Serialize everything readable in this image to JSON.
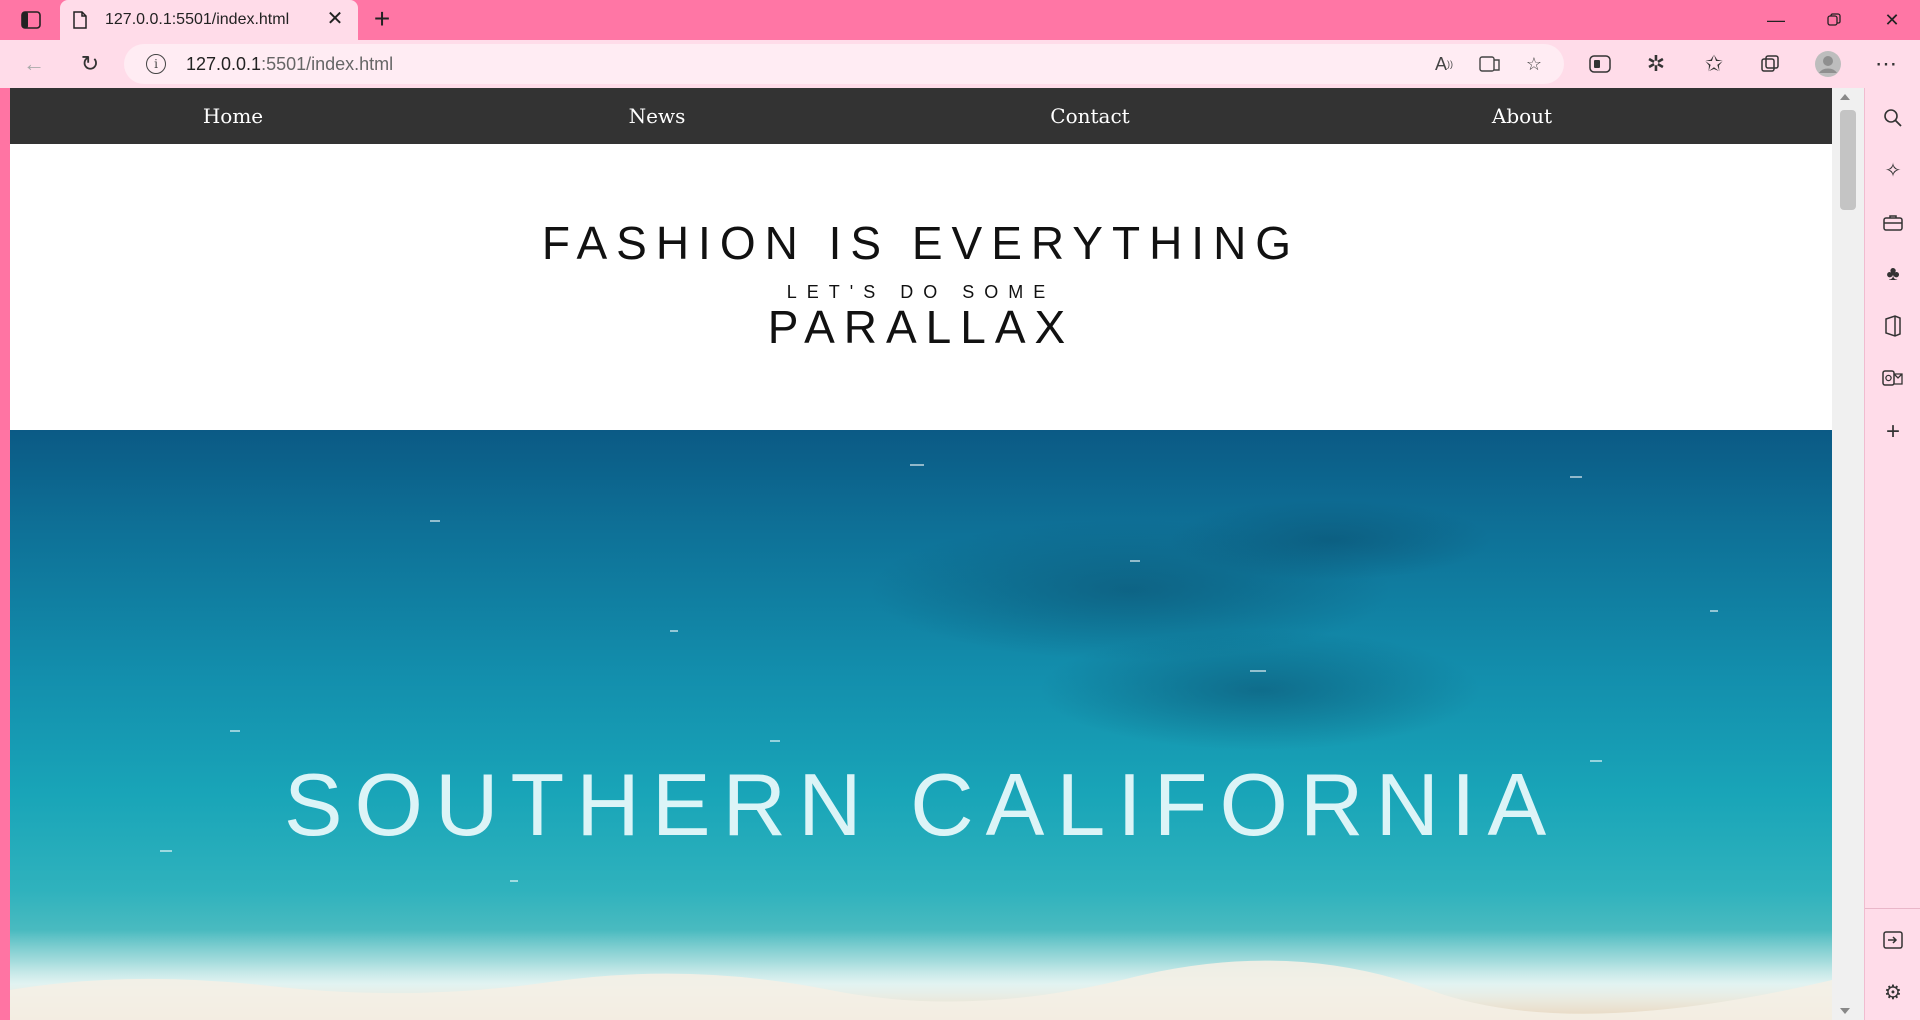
{
  "browser": {
    "tab": {
      "title": "127.0.0.1:5501/index.html"
    },
    "address": {
      "host": "127.0.0.1",
      "rest": ":5501/index.html"
    }
  },
  "site": {
    "nav": [
      "Home",
      "News",
      "Contact",
      "About"
    ],
    "header": {
      "headline": "FASHION IS EVERYTHING",
      "subline": "LET'S DO SOME",
      "subline2": "PARALLAX"
    },
    "hero": {
      "title": "SOUTHERN CALIFORNIA"
    }
  },
  "colors": {
    "tab_strip": "#ff76a5",
    "toolbar": "#ffdce9",
    "navbar": "#333333"
  }
}
